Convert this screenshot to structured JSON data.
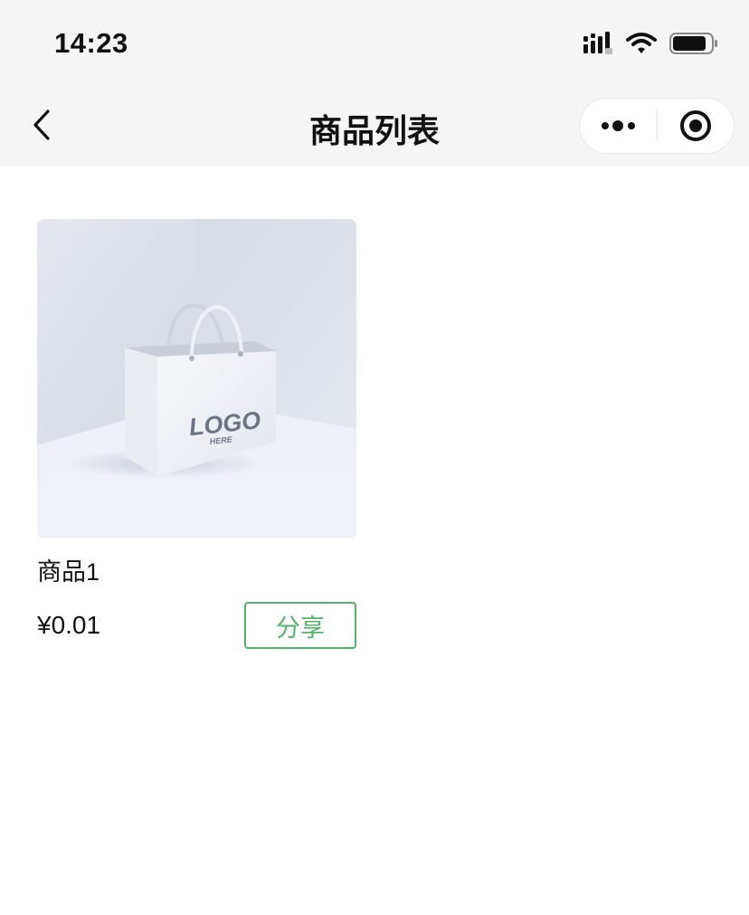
{
  "status_bar": {
    "time": "14:23",
    "icons": [
      "signal-icon",
      "wifi-icon",
      "battery-icon"
    ]
  },
  "nav": {
    "back_icon": "chevron-left-icon",
    "title": "商品列表",
    "capsule": {
      "more_icon": "more-dots-icon",
      "close_icon": "target-circle-icon"
    }
  },
  "products": [
    {
      "name": "商品1",
      "price": "¥0.01",
      "share_label": "分享",
      "image": {
        "logo_text": "LOGO",
        "logo_subtext": "HERE"
      }
    }
  ],
  "colors": {
    "accent_green": "#52b36b",
    "header_bg": "#f5f5f5",
    "text_primary": "#111111"
  }
}
